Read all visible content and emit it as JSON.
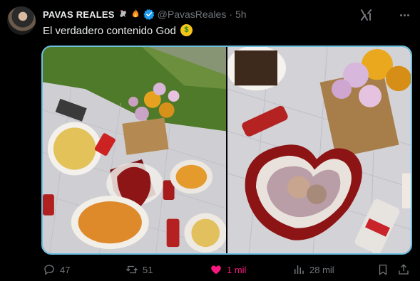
{
  "tweet": {
    "display_name": "PAVAS REALES",
    "name_emojis": [
      "rooster-emoji",
      "fire-emoji"
    ],
    "handle": "@PavasReales",
    "separator": "·",
    "time": "5h",
    "text": "El verdadero contenido God",
    "text_emoji": "money-mouth-face-emoji",
    "media": [
      {
        "description_icon": "photo-picnic-overview"
      },
      {
        "description_icon": "photo-heart-cake"
      }
    ]
  },
  "actions": {
    "replies": "47",
    "reposts": "51",
    "likes": "1 mil",
    "views": "28 mil"
  },
  "colors": {
    "verified": "#1d9bf0",
    "like": "#f91880",
    "muted": "#71767b",
    "media_border": "#6cbfe0"
  }
}
